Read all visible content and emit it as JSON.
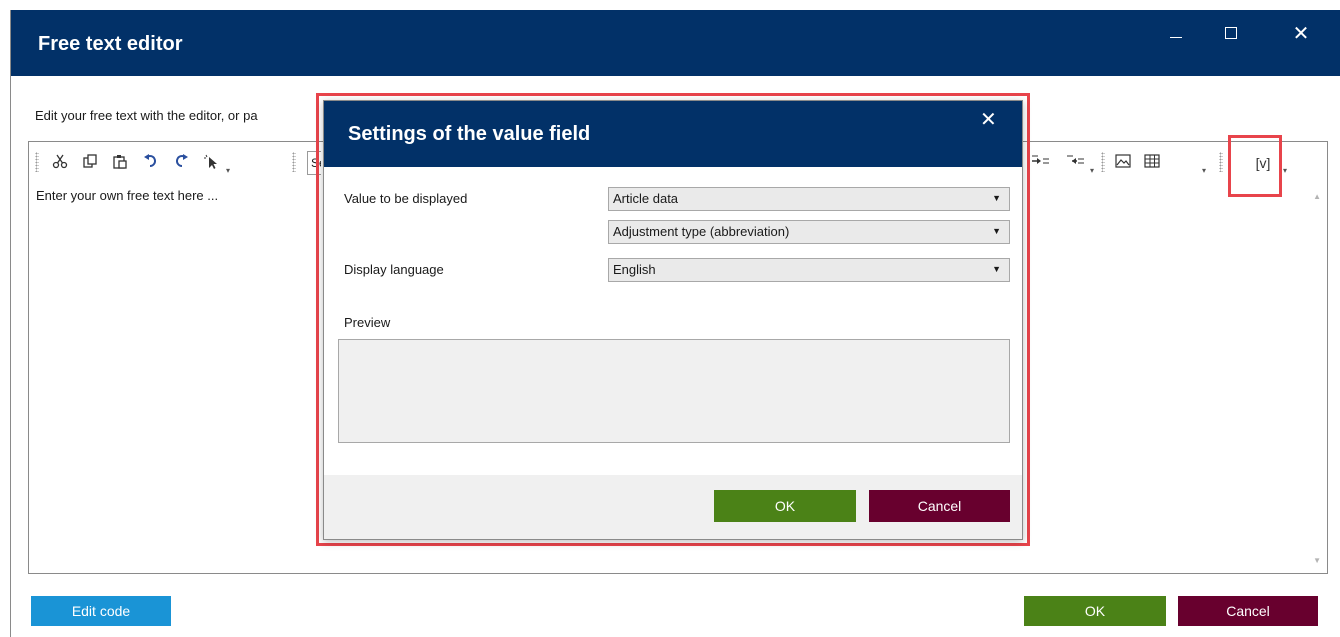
{
  "window": {
    "title": "Free text editor",
    "minimize_label": "Minimize",
    "maximize_label": "Maximize",
    "close_glyph": "✕"
  },
  "instructions": "Edit your free text with the editor, or pa",
  "toolbar": {
    "icons": [
      "cut-icon",
      "copy-icon",
      "paste-icon",
      "undo-icon",
      "redo-icon",
      "select-icon",
      "indent-icon",
      "outdent-icon",
      "image-icon",
      "table-icon"
    ],
    "style_select_value": "Se",
    "value_field_label": "[v]"
  },
  "editor": {
    "placeholder": "Enter your own free text here ..."
  },
  "footer": {
    "edit_code_label": "Edit code",
    "ok_label": "OK",
    "cancel_label": "Cancel"
  },
  "dialog": {
    "title": "Settings of the value field",
    "close_glyph": "✕",
    "value_label": "Value to be displayed",
    "value_option_1": "Article data",
    "value_option_2": "Adjustment type (abbreviation)",
    "language_label": "Display language",
    "language_value": "English",
    "preview_label": "Preview",
    "ok_label": "OK",
    "cancel_label": "Cancel"
  },
  "colors": {
    "titlebar": "#023168",
    "highlight": "#e8444b",
    "ok_green": "#4b8217",
    "cancel_maroon": "#68002e",
    "edit_blue": "#1a94d6"
  }
}
